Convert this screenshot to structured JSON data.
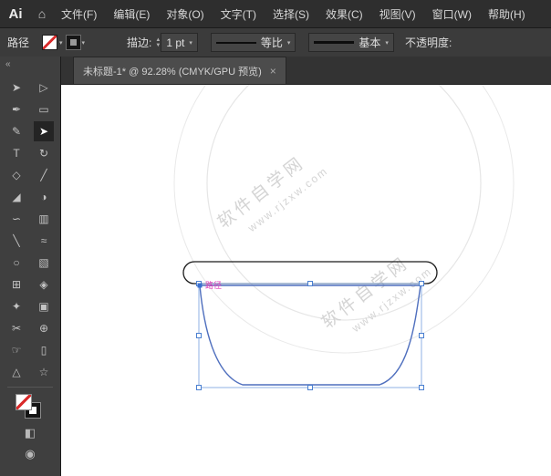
{
  "app": {
    "logo": "Ai"
  },
  "icons": {
    "home": "⌂",
    "caret": "▾",
    "stepper_up": "▲",
    "stepper_down": "▼",
    "collapse": "«",
    "close": "×"
  },
  "menubar": {
    "items": [
      "文件(F)",
      "编辑(E)",
      "对象(O)",
      "文字(T)",
      "选择(S)",
      "效果(C)",
      "视图(V)",
      "窗口(W)",
      "帮助(H)"
    ]
  },
  "control_bar": {
    "selection_type": "路径",
    "stroke_label": "描边:",
    "stroke_value": "1 pt",
    "profile_value": "等比",
    "brush_value": "基本",
    "opacity_label": "不透明度:"
  },
  "tabbar": {
    "tab_title": "未标题-1* @ 92.28% (CMYK/GPU 预览)"
  },
  "toolbar": {
    "active_tool": "selection-tool",
    "tools": [
      {
        "name": "group-selection-tool",
        "glyph": "➤"
      },
      {
        "name": "direct-selection-tool",
        "glyph": "▷"
      },
      {
        "name": "pen-tool",
        "glyph": "✒"
      },
      {
        "name": "rectangle-tool",
        "glyph": "▭"
      },
      {
        "name": "paintbrush-tool",
        "glyph": "✎"
      },
      {
        "name": "selection-tool",
        "glyph": "➤",
        "active": true
      },
      {
        "name": "type-tool",
        "glyph": "T"
      },
      {
        "name": "rotate-tool",
        "glyph": "↻"
      },
      {
        "name": "eraser-tool",
        "glyph": "◇"
      },
      {
        "name": "knife-tool",
        "glyph": "╱"
      },
      {
        "name": "eyedropper-tool",
        "glyph": "◢"
      },
      {
        "name": "blend-tool",
        "glyph": "◑"
      },
      {
        "name": "curvature-tool",
        "glyph": "∽"
      },
      {
        "name": "column-graph-tool",
        "glyph": "▥"
      },
      {
        "name": "slice-tool",
        "glyph": "╲"
      },
      {
        "name": "width-tool",
        "glyph": "≈"
      },
      {
        "name": "ellipse-tool",
        "glyph": "○"
      },
      {
        "name": "gradient-tool",
        "glyph": "▧"
      },
      {
        "name": "mesh-tool",
        "glyph": "⊞"
      },
      {
        "name": "shape-builder-tool",
        "glyph": "◈"
      },
      {
        "name": "symbol-sprayer-tool",
        "glyph": "✦"
      },
      {
        "name": "free-transform-tool",
        "glyph": "▣"
      },
      {
        "name": "scissors-tool",
        "glyph": "✂"
      },
      {
        "name": "zoom-tool",
        "glyph": "⊕"
      },
      {
        "name": "hand-tool",
        "glyph": "☞"
      },
      {
        "name": "artboard-tool",
        "glyph": "▯"
      },
      {
        "name": "perspective-grid-tool",
        "glyph": "△"
      },
      {
        "name": "star-tool",
        "glyph": "☆"
      }
    ],
    "bottom_tools": [
      {
        "name": "draw-mode-icon",
        "glyph": "◧"
      },
      {
        "name": "screen-mode-icon",
        "glyph": "◉"
      }
    ]
  },
  "canvas": {
    "path_label": "路径",
    "watermark": {
      "line1": "软件自学网",
      "line2": "www.rjzxw.com"
    }
  },
  "colors": {
    "selection_blue": "#4a7fd0",
    "path_stroke_blue": "#4f6fbe",
    "path_label_pink": "#e03db8",
    "outline_black": "#1a1a1a",
    "watermark_gray": "#d6d6d6"
  }
}
